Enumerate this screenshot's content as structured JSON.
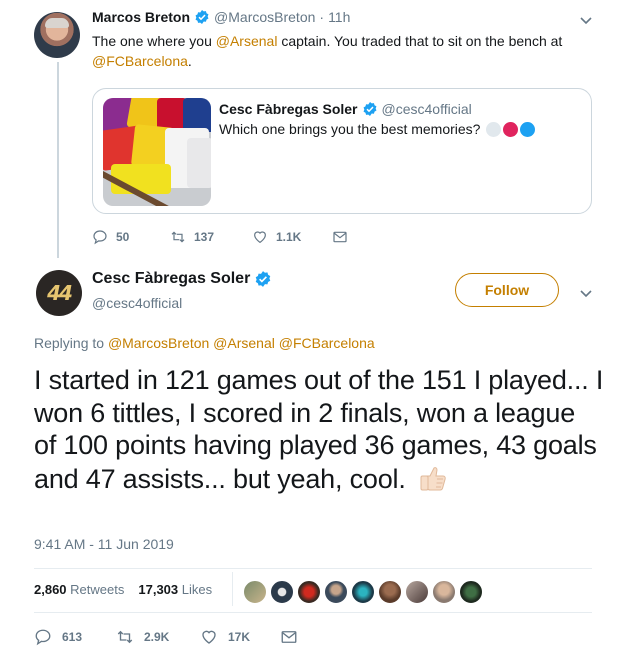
{
  "reply_tweet": {
    "author_name": "Marcos Breton",
    "handle": "@MarcosBreton",
    "separator": "·",
    "time": "11h",
    "text_part1": "The one where you ",
    "mention1": "@Arsenal",
    "text_part2": " captain. You traded that to sit on the bench at",
    "mention2": "@FCBarcelona",
    "text_part3": ".",
    "quote": {
      "author_name": "Cesc Fàbregas Soler",
      "handle": "@cesc4official",
      "text": "Which one brings you the best memories?",
      "circle_colors": [
        "#e1e8ed",
        "#e0245e",
        "#1da1f2"
      ]
    },
    "actions": {
      "replies": "50",
      "retweets": "137",
      "likes": "1.1K"
    }
  },
  "main_tweet": {
    "avatar_text": "4",
    "author_name": "Cesc Fàbregas Soler",
    "handle": "@cesc4official",
    "follow_label": "Follow",
    "replying_prefix": "Replying to ",
    "replying_mentions": "@MarcosBreton @Arsenal @FCBarcelona",
    "text": "I started in 121 games out of the 151 I played... I won 6 tittles, I scored in 2 finals, won a league of 100 points having played 36 games, 43 goals and 47 assists... but yeah, cool.",
    "thumb_emoji": "thumbs-up-light-skin",
    "timestamp": "9:41 AM - 11 Jun 2019",
    "retweets_count": "2,860",
    "retweets_label": "Retweets",
    "likes_count": "17,303",
    "likes_label": "Likes",
    "actions": {
      "replies": "613",
      "retweets": "2.9K",
      "likes": "17K"
    }
  },
  "colors": {
    "accent": "#c47f00",
    "verified": "#1da1f2",
    "muted": "#657786"
  }
}
